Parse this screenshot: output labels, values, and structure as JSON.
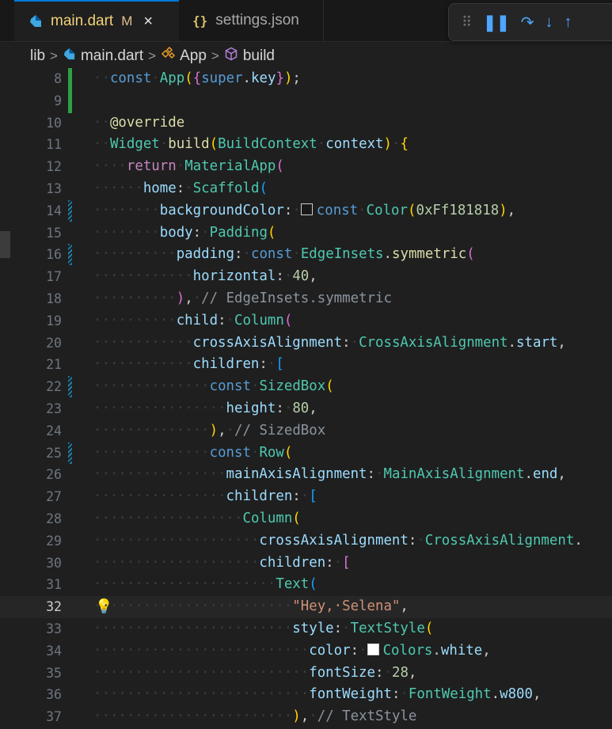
{
  "tabs": [
    {
      "label": "main.dart",
      "modified": "M",
      "close": "×",
      "icon": "dart-icon",
      "active": true
    },
    {
      "label": "settings.json",
      "icon": "json-braces-icon",
      "braces": "{}",
      "active": false
    }
  ],
  "debug_toolbar": {
    "grip": "⠿",
    "pause": "❚❚",
    "step_over": "↷",
    "step_into": "↓",
    "step_out": "↑"
  },
  "breadcrumbs": {
    "folder": "lib",
    "file": "main.dart",
    "class": "App",
    "method": "build",
    "separator": ">"
  },
  "colors": {
    "accent": "#0078d4",
    "background": "#1f1f1f",
    "added": "#2ea043",
    "modified": "#1b81a8"
  },
  "lightbulb": "💡",
  "lines": [
    {
      "n": "8",
      "gutter": "add",
      "tokens": [
        [
          "ind",
          "··"
        ],
        [
          "kw",
          "const"
        ],
        [
          "ind",
          "·"
        ],
        [
          "ty",
          "App"
        ],
        [
          "b1",
          "("
        ],
        [
          "b2",
          "{"
        ],
        [
          "kw",
          "super"
        ],
        [
          "",
          "."
        ],
        [
          "prm",
          "key"
        ],
        [
          "b2",
          "}"
        ],
        [
          "b1",
          ")"
        ],
        [
          "",
          ";"
        ]
      ]
    },
    {
      "n": "9",
      "gutter": "add",
      "tokens": []
    },
    {
      "n": "10",
      "tokens": [
        [
          "ind",
          "··"
        ],
        [
          "ann",
          "@override"
        ]
      ]
    },
    {
      "n": "11",
      "tokens": [
        [
          "ind",
          "··"
        ],
        [
          "ty",
          "Widget"
        ],
        [
          "ind",
          "·"
        ],
        [
          "fn",
          "build"
        ],
        [
          "b1",
          "("
        ],
        [
          "ty",
          "BuildContext"
        ],
        [
          "ind",
          "·"
        ],
        [
          "prm",
          "context"
        ],
        [
          "b1",
          ")"
        ],
        [
          "ind",
          "·"
        ],
        [
          "b1",
          "{"
        ]
      ]
    },
    {
      "n": "12",
      "tokens": [
        [
          "ind",
          "····"
        ],
        [
          "kw2",
          "return"
        ],
        [
          "ind",
          "·"
        ],
        [
          "ty",
          "MaterialApp"
        ],
        [
          "b2",
          "("
        ]
      ]
    },
    {
      "n": "13",
      "tokens": [
        [
          "ind",
          "······"
        ],
        [
          "prm",
          "home"
        ],
        [
          "",
          ":"
        ],
        [
          "ind",
          "·"
        ],
        [
          "ty",
          "Scaffold"
        ],
        [
          "b3",
          "("
        ]
      ]
    },
    {
      "n": "14",
      "gutter": "mod",
      "tokens": [
        [
          "ind",
          "········"
        ],
        [
          "prm",
          "backgroundColor"
        ],
        [
          "",
          ":"
        ],
        [
          "ind",
          "·"
        ],
        [
          "sw",
          "#181818"
        ],
        [
          "kw",
          "const"
        ],
        [
          "ind",
          "·"
        ],
        [
          "ty",
          "Color"
        ],
        [
          "b1",
          "("
        ],
        [
          "num",
          "0xFf181818"
        ],
        [
          "b1",
          ")"
        ],
        [
          "",
          ","
        ]
      ]
    },
    {
      "n": "15",
      "tokens": [
        [
          "ind",
          "········"
        ],
        [
          "prm",
          "body"
        ],
        [
          "",
          ":"
        ],
        [
          "ind",
          "·"
        ],
        [
          "ty",
          "Padding"
        ],
        [
          "b1",
          "("
        ]
      ]
    },
    {
      "n": "16",
      "gutter": "mod",
      "tokens": [
        [
          "ind",
          "··········"
        ],
        [
          "prm",
          "padding"
        ],
        [
          "",
          ":"
        ],
        [
          "ind",
          "·"
        ],
        [
          "kw",
          "const"
        ],
        [
          "ind",
          "·"
        ],
        [
          "ty",
          "EdgeInsets"
        ],
        [
          "",
          "."
        ],
        [
          "fn",
          "symmetric"
        ],
        [
          "b2",
          "("
        ]
      ]
    },
    {
      "n": "17",
      "tokens": [
        [
          "ind",
          "············"
        ],
        [
          "prm",
          "horizontal"
        ],
        [
          "",
          ":"
        ],
        [
          "ind",
          "·"
        ],
        [
          "num",
          "40"
        ],
        [
          "",
          ","
        ]
      ]
    },
    {
      "n": "18",
      "tokens": [
        [
          "ind",
          "··········"
        ],
        [
          "b2",
          ")"
        ],
        [
          "",
          ","
        ],
        [
          "ind",
          "·"
        ],
        [
          "cm",
          "// EdgeInsets.symmetric"
        ]
      ]
    },
    {
      "n": "19",
      "tokens": [
        [
          "ind",
          "··········"
        ],
        [
          "prm",
          "child"
        ],
        [
          "",
          ":"
        ],
        [
          "ind",
          "·"
        ],
        [
          "ty",
          "Column"
        ],
        [
          "b2",
          "("
        ]
      ]
    },
    {
      "n": "20",
      "tokens": [
        [
          "ind",
          "············"
        ],
        [
          "prm",
          "crossAxisAlignment"
        ],
        [
          "",
          ":"
        ],
        [
          "ind",
          "·"
        ],
        [
          "ty",
          "CrossAxisAlignment"
        ],
        [
          "",
          "."
        ],
        [
          "prm",
          "start"
        ],
        [
          "",
          ","
        ]
      ]
    },
    {
      "n": "21",
      "tokens": [
        [
          "ind",
          "············"
        ],
        [
          "prm",
          "children"
        ],
        [
          "",
          ":"
        ],
        [
          "ind",
          "·"
        ],
        [
          "b3",
          "["
        ]
      ]
    },
    {
      "n": "22",
      "gutter": "mod",
      "tokens": [
        [
          "ind",
          "··············"
        ],
        [
          "kw",
          "const"
        ],
        [
          "ind",
          "·"
        ],
        [
          "ty",
          "SizedBox"
        ],
        [
          "b1",
          "("
        ]
      ]
    },
    {
      "n": "23",
      "tokens": [
        [
          "ind",
          "················"
        ],
        [
          "prm",
          "height"
        ],
        [
          "",
          ":"
        ],
        [
          "ind",
          "·"
        ],
        [
          "num",
          "80"
        ],
        [
          "",
          ","
        ]
      ]
    },
    {
      "n": "24",
      "tokens": [
        [
          "ind",
          "··············"
        ],
        [
          "b1",
          ")"
        ],
        [
          "",
          ","
        ],
        [
          "ind",
          "·"
        ],
        [
          "cm",
          "// SizedBox"
        ]
      ]
    },
    {
      "n": "25",
      "gutter": "mod",
      "tokens": [
        [
          "ind",
          "··············"
        ],
        [
          "kw",
          "const"
        ],
        [
          "ind",
          "·"
        ],
        [
          "ty",
          "Row"
        ],
        [
          "b1",
          "("
        ]
      ]
    },
    {
      "n": "26",
      "tokens": [
        [
          "ind",
          "················"
        ],
        [
          "prm",
          "mainAxisAlignment"
        ],
        [
          "",
          ":"
        ],
        [
          "ind",
          "·"
        ],
        [
          "ty",
          "MainAxisAlignment"
        ],
        [
          "",
          "."
        ],
        [
          "prm",
          "end"
        ],
        [
          "",
          ","
        ]
      ]
    },
    {
      "n": "27",
      "tokens": [
        [
          "ind",
          "················"
        ],
        [
          "prm",
          "children"
        ],
        [
          "",
          ":"
        ],
        [
          "ind",
          "·"
        ],
        [
          "b3",
          "["
        ]
      ]
    },
    {
      "n": "28",
      "tokens": [
        [
          "ind",
          "··················"
        ],
        [
          "ty",
          "Column"
        ],
        [
          "b1",
          "("
        ]
      ]
    },
    {
      "n": "29",
      "tokens": [
        [
          "ind",
          "····················"
        ],
        [
          "prm",
          "crossAxisAlignment"
        ],
        [
          "",
          ":"
        ],
        [
          "ind",
          "·"
        ],
        [
          "ty",
          "CrossAxisAlignment"
        ],
        [
          "",
          "."
        ]
      ]
    },
    {
      "n": "30",
      "tokens": [
        [
          "ind",
          "····················"
        ],
        [
          "prm",
          "children"
        ],
        [
          "",
          ":"
        ],
        [
          "ind",
          "·"
        ],
        [
          "b2",
          "["
        ]
      ]
    },
    {
      "n": "31",
      "tokens": [
        [
          "ind",
          "······················"
        ],
        [
          "ty",
          "Text"
        ],
        [
          "b3",
          "("
        ]
      ]
    },
    {
      "n": "32",
      "active": true,
      "bulb": true,
      "tokens": [
        [
          "ind",
          "························"
        ],
        [
          "str",
          "\"Hey,·Selena\""
        ],
        [
          "",
          ","
        ]
      ]
    },
    {
      "n": "33",
      "tokens": [
        [
          "ind",
          "························"
        ],
        [
          "prm",
          "style"
        ],
        [
          "",
          ":"
        ],
        [
          "ind",
          "·"
        ],
        [
          "ty",
          "TextStyle"
        ],
        [
          "b1",
          "("
        ]
      ]
    },
    {
      "n": "34",
      "tokens": [
        [
          "ind",
          "··························"
        ],
        [
          "prm",
          "color"
        ],
        [
          "",
          ":"
        ],
        [
          "ind",
          "·"
        ],
        [
          "sw",
          "#ffffff"
        ],
        [
          "ty",
          "Colors"
        ],
        [
          "",
          "."
        ],
        [
          "prm",
          "white"
        ],
        [
          "",
          ","
        ]
      ]
    },
    {
      "n": "35",
      "tokens": [
        [
          "ind",
          "··························"
        ],
        [
          "prm",
          "fontSize"
        ],
        [
          "",
          ":"
        ],
        [
          "ind",
          "·"
        ],
        [
          "num",
          "28"
        ],
        [
          "",
          ","
        ]
      ]
    },
    {
      "n": "36",
      "tokens": [
        [
          "ind",
          "··························"
        ],
        [
          "prm",
          "fontWeight"
        ],
        [
          "",
          ":"
        ],
        [
          "ind",
          "·"
        ],
        [
          "ty",
          "FontWeight"
        ],
        [
          "",
          "."
        ],
        [
          "prm",
          "w800"
        ],
        [
          "",
          ","
        ]
      ]
    },
    {
      "n": "37",
      "tokens": [
        [
          "ind",
          "························"
        ],
        [
          "b1",
          ")"
        ],
        [
          "",
          ","
        ],
        [
          "ind",
          "·"
        ],
        [
          "cm",
          "// TextStyle"
        ]
      ]
    }
  ]
}
